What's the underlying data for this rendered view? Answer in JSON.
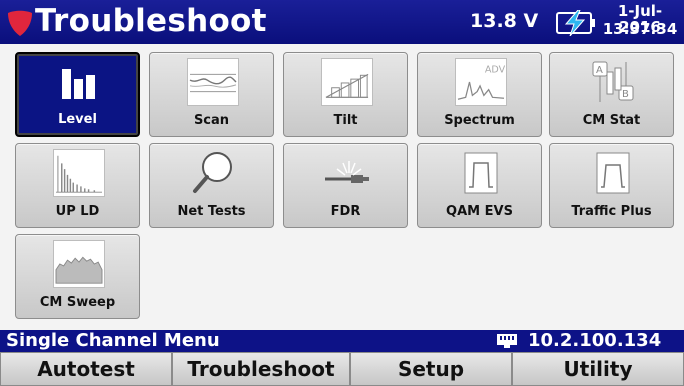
{
  "header": {
    "title": "Troubleshoot",
    "voltage": "13.8 V",
    "date": "1-Jul-2016",
    "time": "13:37:34",
    "icons": [
      "shield-icon",
      "battery-charging-icon"
    ],
    "colors": {
      "header_bg": "#0a0f7c",
      "shield": "#e0263d"
    }
  },
  "tiles": [
    {
      "label": "Level",
      "icon": "level-bars-icon",
      "selected": true
    },
    {
      "label": "Scan",
      "icon": "scan-trace-icon"
    },
    {
      "label": "Tilt",
      "icon": "tilt-icon"
    },
    {
      "label": "Spectrum",
      "icon": "spectrum-adv-icon",
      "icon_text": "ADV"
    },
    {
      "label": "CM Stat",
      "icon": "cm-stat-icon",
      "icon_text_a": "A",
      "icon_text_b": "B"
    },
    {
      "label": "UP LD",
      "icon": "upstream-load-icon"
    },
    {
      "label": "Net Tests",
      "icon": "magnifier-icon"
    },
    {
      "label": "FDR",
      "icon": "fdr-connector-icon"
    },
    {
      "label": "QAM EVS",
      "icon": "qam-evs-icon"
    },
    {
      "label": "Traffic Plus",
      "icon": "traffic-plus-icon"
    },
    {
      "label": "CM Sweep",
      "icon": "cm-sweep-icon"
    }
  ],
  "status": {
    "menu_title": "Single Channel Menu",
    "ip": "10.2.100.134",
    "icon": "network-icon"
  },
  "softkeys": [
    "Autotest",
    "Troubleshoot",
    "Setup",
    "Utility"
  ]
}
